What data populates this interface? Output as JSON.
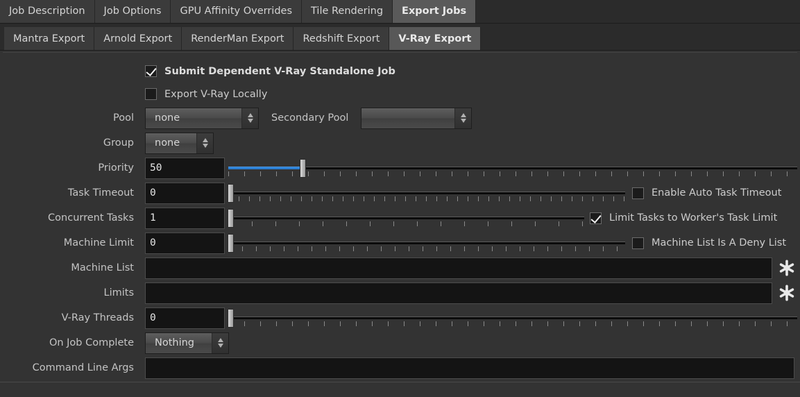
{
  "window": {
    "title": "Export Jobs - V-Ray Export"
  },
  "primary_tabs": [
    {
      "label": "Job Description",
      "active": false
    },
    {
      "label": "Job Options",
      "active": false
    },
    {
      "label": "GPU Affinity Overrides",
      "active": false
    },
    {
      "label": "Tile Rendering",
      "active": false
    },
    {
      "label": "Export Jobs",
      "active": true
    }
  ],
  "secondary_tabs": [
    {
      "label": "Mantra Export",
      "active": false
    },
    {
      "label": "Arnold Export",
      "active": false
    },
    {
      "label": "RenderMan Export",
      "active": false
    },
    {
      "label": "Redshift Export",
      "active": false
    },
    {
      "label": "V-Ray Export",
      "active": true
    }
  ],
  "form": {
    "submit_dependent": {
      "label": "Submit Dependent V-Ray Standalone Job",
      "checked": true
    },
    "export_locally": {
      "label": "Export V-Ray Locally",
      "checked": false
    },
    "pool": {
      "label": "Pool",
      "value": "none"
    },
    "secondary_pool": {
      "label": "Secondary Pool",
      "value": ""
    },
    "group": {
      "label": "Group",
      "value": "none"
    },
    "priority": {
      "label": "Priority",
      "value": "50",
      "slider_percent": 13
    },
    "task_timeout": {
      "label": "Task Timeout",
      "value": "0",
      "slider_percent": 0,
      "checkbox_label": "Enable Auto Task Timeout",
      "checkbox_checked": false
    },
    "concurrent_tasks": {
      "label": "Concurrent Tasks",
      "value": "1",
      "slider_percent": 0,
      "checkbox_label": "Limit Tasks to Worker's Task Limit",
      "checkbox_checked": true
    },
    "machine_limit": {
      "label": "Machine Limit",
      "value": "0",
      "slider_percent": 0,
      "checkbox_label": "Machine List Is A Deny List",
      "checkbox_checked": false
    },
    "machine_list": {
      "label": "Machine List",
      "value": "",
      "button_icon": "gear-icon"
    },
    "limits": {
      "label": "Limits",
      "value": "",
      "button_icon": "gear-icon"
    },
    "vray_threads": {
      "label": "V-Ray Threads",
      "value": "0",
      "slider_percent": 0
    },
    "on_job_complete": {
      "label": "On Job Complete",
      "value": "Nothing"
    },
    "command_line_args": {
      "label": "Command Line Args",
      "value": ""
    }
  },
  "colors": {
    "background": "#333333",
    "tab_inactive": "#3b3b3b",
    "tab_active": "#5a5a5a",
    "accent_slider": "#2b7fd4",
    "input_bg": "#141414",
    "text": "#c4c4c4"
  }
}
